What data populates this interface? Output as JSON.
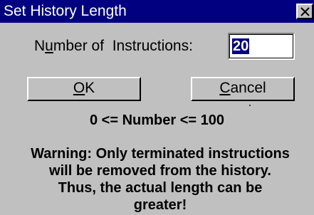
{
  "dialog": {
    "title": "Set History Length",
    "close_icon": "close-icon"
  },
  "field": {
    "label_prefix": "N",
    "label_accel": "u",
    "label_rest": "mber of  Instructions:",
    "value": "20"
  },
  "buttons": {
    "ok_accel": "O",
    "ok_rest": "K",
    "cancel_accel": "C",
    "cancel_rest": "ancel"
  },
  "range_text": "0 <= Number <= 100",
  "warning": {
    "lines": [
      "Warning: Only terminated instructions",
      "will be removed from the history.",
      "Thus, the actual length can be",
      "greater!"
    ]
  },
  "colors": {
    "titlebar": "#000080",
    "face": "#c0c0c0",
    "selection": "#000080"
  }
}
